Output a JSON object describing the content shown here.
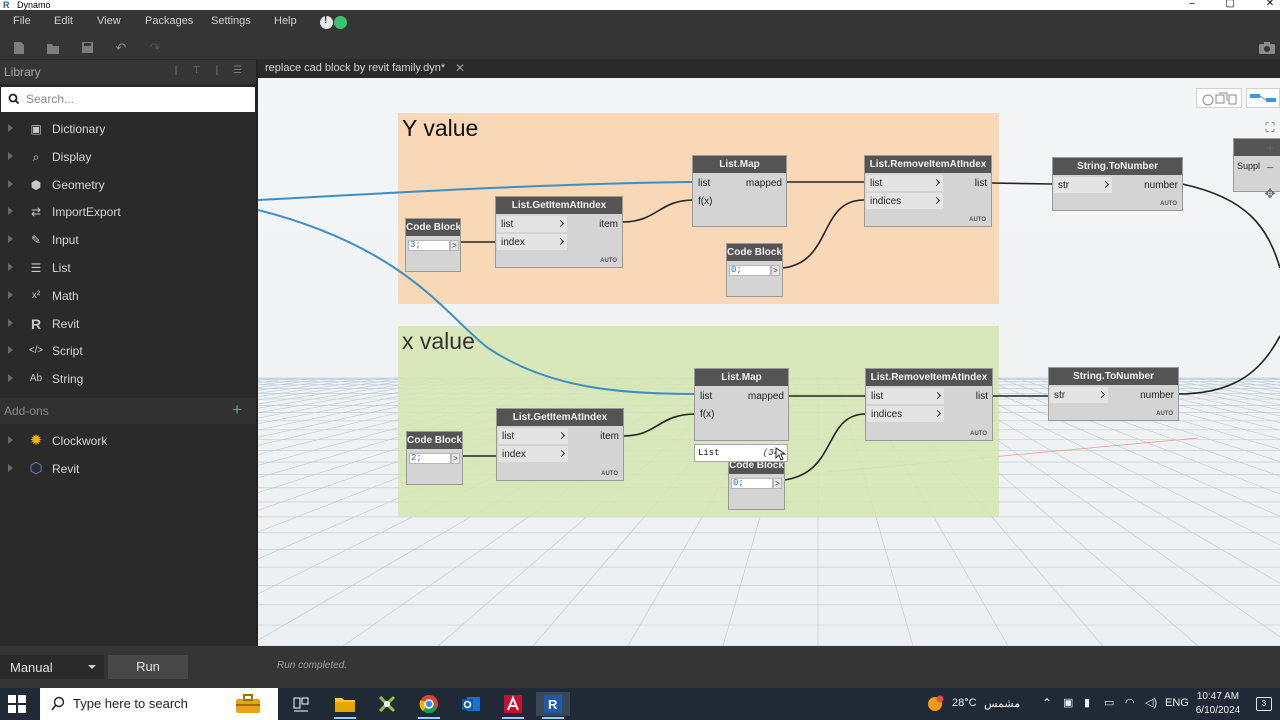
{
  "window": {
    "title": "Dynamo",
    "logo_letter": "R"
  },
  "menu": {
    "items": [
      "File",
      "Edit",
      "View",
      "Packages",
      "Settings",
      "Help"
    ]
  },
  "library": {
    "title": "Library",
    "search_placeholder": "Search...",
    "items": [
      {
        "label": "Dictionary",
        "icon": "dictionary-icon"
      },
      {
        "label": "Display",
        "icon": "magnifier-icon"
      },
      {
        "label": "Geometry",
        "icon": "cube-icon"
      },
      {
        "label": "ImportExport",
        "icon": "arrows-icon"
      },
      {
        "label": "Input",
        "icon": "pencil-icon"
      },
      {
        "label": "List",
        "icon": "list-icon"
      },
      {
        "label": "Math",
        "icon": "math-icon"
      },
      {
        "label": "Revit",
        "icon": "revit-icon"
      },
      {
        "label": "Script",
        "icon": "code-icon"
      },
      {
        "label": "String",
        "icon": "string-icon"
      }
    ],
    "addons_label": "Add-ons",
    "addons": [
      {
        "label": "Clockwork",
        "icon": "gear-icon"
      },
      {
        "label": "Revit",
        "icon": "revit-package-icon"
      }
    ]
  },
  "tab": {
    "label": "replace cad block by revit family.dyn*"
  },
  "groups": {
    "y": {
      "title": "Y value",
      "color": "#f9d8b8"
    },
    "x": {
      "title": "x value",
      "color": "#d5e6b0"
    }
  },
  "nodes": {
    "cb_y": {
      "title": "Code Block",
      "code": "3;",
      "out": ">"
    },
    "gi_y": {
      "title": "List.GetItemAtIndex",
      "in1": "list",
      "in2": "index",
      "out": "item",
      "lacing": "AUTO"
    },
    "map_y": {
      "title": "List.Map",
      "in1": "list",
      "in2": "f(x)",
      "out": "mapped"
    },
    "cb0_y": {
      "title": "Code Block",
      "code": "0;",
      "out": ">"
    },
    "rm_y": {
      "title": "List.RemoveItemAtIndex",
      "in1": "list",
      "in2": "indices",
      "out": "list",
      "lacing": "AUTO"
    },
    "stn_y": {
      "title": "String.ToNumber",
      "in1": "str",
      "out": "number",
      "lacing": "AUTO"
    },
    "cb_x": {
      "title": "Code Block",
      "code": "2;",
      "out": ">"
    },
    "gi_x": {
      "title": "List.GetItemAtIndex",
      "in1": "list",
      "in2": "index",
      "out": "item",
      "lacing": "AUTO"
    },
    "map_x": {
      "title": "List.Map",
      "in1": "list",
      "in2": "f(x)",
      "out": "mapped"
    },
    "cb0_x": {
      "title": "Code Block",
      "code": "0;",
      "out": ">"
    },
    "rm_x": {
      "title": "List.RemoveItemAtIndex",
      "in1": "list",
      "in2": "indices",
      "out": "list",
      "lacing": "AUTO"
    },
    "stn_x": {
      "title": "String.ToNumber",
      "in1": "str",
      "out": "number",
      "lacing": "AUTO"
    },
    "supply": {
      "title": "Suppl"
    }
  },
  "tooltip": {
    "text": "List",
    "count": "(34"
  },
  "runbar": {
    "mode": "Manual",
    "run_label": "Run",
    "status": "Run completed."
  },
  "taskbar": {
    "search_placeholder": "Type here to search",
    "weather": "28°C",
    "weather_desc": "مشمس",
    "language": "ENG",
    "time": "10:47 AM",
    "date": "6/10/2024",
    "notifications": "3"
  }
}
